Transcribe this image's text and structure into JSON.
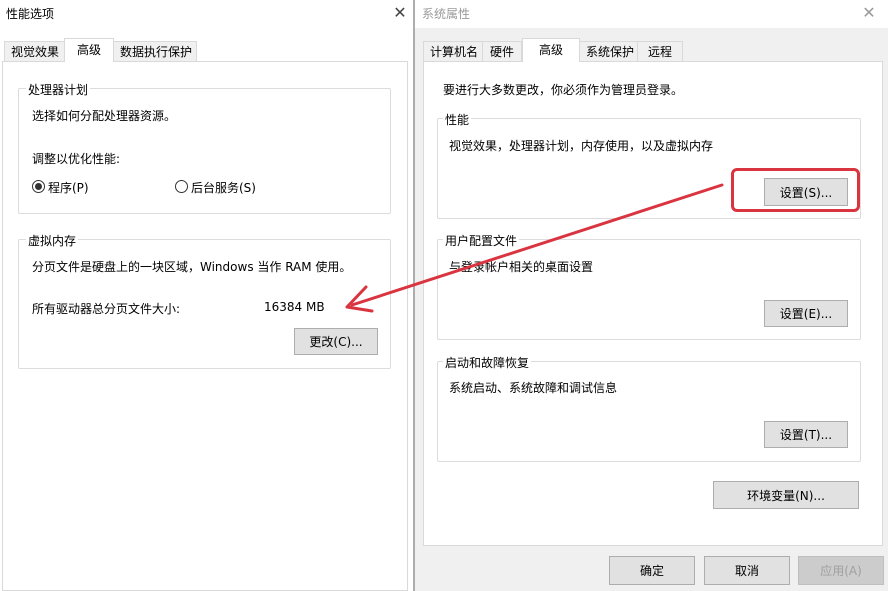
{
  "left": {
    "title": "性能选项",
    "close_glyph": "✕",
    "tabs": [
      {
        "label": "视觉效果",
        "active": false
      },
      {
        "label": "高级",
        "active": true
      },
      {
        "label": "数据执行保护",
        "active": false
      }
    ],
    "processor": {
      "group_title": "处理器计划",
      "description": "选择如何分配处理器资源。",
      "adjust_label": "调整以优化性能:",
      "options": [
        {
          "label": "程序(P)",
          "checked": true
        },
        {
          "label": "后台服务(S)",
          "checked": false
        }
      ]
    },
    "virtual_memory": {
      "group_title": "虚拟内存",
      "description": "分页文件是硬盘上的一块区域，Windows 当作 RAM 使用。",
      "total_label": "所有驱动器总分页文件大小:",
      "total_value": "16384 MB",
      "change_button": "更改(C)..."
    }
  },
  "right": {
    "title": "系统属性",
    "close_glyph": "✕",
    "tabs": [
      {
        "label": "计算机名",
        "active": false
      },
      {
        "label": "硬件",
        "active": false
      },
      {
        "label": "高级",
        "active": true
      },
      {
        "label": "系统保护",
        "active": false
      },
      {
        "label": "远程",
        "active": false
      }
    ],
    "admin_note": "要进行大多数更改，你必须作为管理员登录。",
    "performance": {
      "group_title": "性能",
      "description": "视觉效果，处理器计划，内存使用，以及虚拟内存",
      "settings_button": "设置(S)..."
    },
    "user_profiles": {
      "group_title": "用户配置文件",
      "description": "与登录帐户相关的桌面设置",
      "settings_button": "设置(E)..."
    },
    "startup_recovery": {
      "group_title": "启动和故障恢复",
      "description": "系统启动、系统故障和调试信息",
      "settings_button": "设置(T)..."
    },
    "env_vars_button": "环境变量(N)...",
    "footer": {
      "ok": "确定",
      "cancel": "取消",
      "apply": "应用(A)"
    }
  },
  "annotation": {
    "highlight_color": "#d9343f",
    "arrow_color": "#d9343f"
  }
}
